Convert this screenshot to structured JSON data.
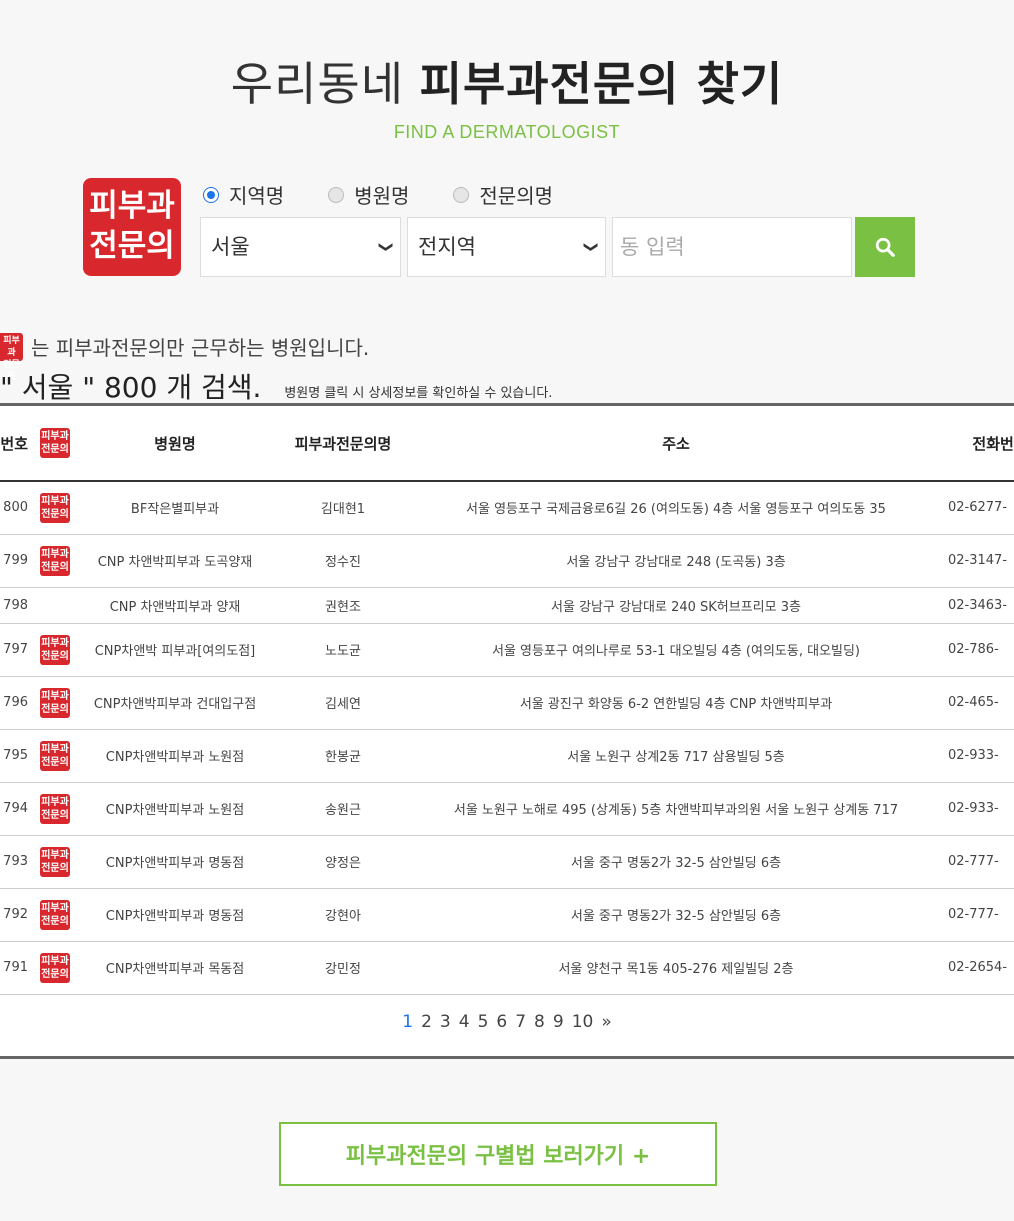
{
  "header": {
    "title_light": "우리동네",
    "title_bold": "피부과전문의 찾기",
    "subtitle": "FIND A DERMATOLOGIST"
  },
  "logo": {
    "line1": "피부과",
    "line2": "전문의"
  },
  "search": {
    "radios": [
      {
        "label": "지역명",
        "checked": true
      },
      {
        "label": "병원명",
        "checked": false
      },
      {
        "label": "전문의명",
        "checked": false
      }
    ],
    "region": "서울",
    "district": "전지역",
    "dong_placeholder": "동 입력",
    "button_icon": "search-icon",
    "accent_color": "#7ac143"
  },
  "note": {
    "badge_line1": "피부과",
    "badge_line2": "전문의",
    "text": "는 피부과전문의만 근무하는 병원입니다."
  },
  "result": {
    "summary": "\" 서울 \" 800 개 검색.",
    "hint": "병원명 클릭 시 상세정보를 확인하실 수 있습니다."
  },
  "table": {
    "headers": [
      "번호",
      "",
      "병원명",
      "피부과전문의명",
      "주소",
      "전화번호"
    ],
    "badge_line1": "피부과",
    "badge_line2": "전문의",
    "rows": [
      {
        "no": "800",
        "badge": true,
        "hospital": "BF작은별피부과",
        "doctor": "김대현1",
        "address": "서울 영등포구 국제금융로6길 26 (여의도동) 4층 서울 영등포구 여의도동 35",
        "phone": "02-6277-"
      },
      {
        "no": "799",
        "badge": true,
        "hospital": "CNP 차앤박피부과 도곡양재",
        "doctor": "정수진",
        "address": "서울 강남구 강남대로 248 (도곡동) 3층",
        "phone": "02-3147-"
      },
      {
        "no": "798",
        "badge": false,
        "hospital": "CNP 차앤박피부과 양재",
        "doctor": "권현조",
        "address": "서울 강남구 강남대로 240 SK허브프리모 3층",
        "phone": "02-3463-"
      },
      {
        "no": "797",
        "badge": true,
        "hospital": "CNP차앤박 피부과[여의도점]",
        "doctor": "노도균",
        "address": "서울 영등포구 여의나루로 53-1 대오빌딩 4층 (여의도동, 대오빌딩)",
        "phone": "02-786-"
      },
      {
        "no": "796",
        "badge": true,
        "hospital": "CNP차앤박피부과 건대입구점",
        "doctor": "김세연",
        "address": "서울 광진구 화양동 6-2 연한빌딩 4층 CNP 차앤박피부과",
        "phone": "02-465-"
      },
      {
        "no": "795",
        "badge": true,
        "hospital": "CNP차앤박피부과 노원점",
        "doctor": "한봉균",
        "address": "서울 노원구 상계2동 717 삼용빌딩 5층",
        "phone": "02-933-"
      },
      {
        "no": "794",
        "badge": true,
        "hospital": "CNP차앤박피부과 노원점",
        "doctor": "송원근",
        "address": "서울 노원구 노해로 495 (상계동) 5층 차앤박피부과의원 서울 노원구 상계동 717",
        "phone": "02-933-"
      },
      {
        "no": "793",
        "badge": true,
        "hospital": "CNP차앤박피부과 명동점",
        "doctor": "양정은",
        "address": "서울 중구 명동2가 32-5 삼안빌딩 6층",
        "phone": "02-777-"
      },
      {
        "no": "792",
        "badge": true,
        "hospital": "CNP차앤박피부과 명동점",
        "doctor": "강현아",
        "address": "서울 중구 명동2가 32-5 삼안빌딩 6층",
        "phone": "02-777-"
      },
      {
        "no": "791",
        "badge": true,
        "hospital": "CNP차앤박피부과 목동점",
        "doctor": "강민정",
        "address": "서울 양천구 목1동 405-276 제일빌딩 2층",
        "phone": "02-2654-"
      }
    ]
  },
  "pagination": {
    "pages": [
      "1",
      "2",
      "3",
      "4",
      "5",
      "6",
      "7",
      "8",
      "9",
      "10"
    ],
    "current": "1",
    "next": "»"
  },
  "guide_button": "피부과전문의 구별법 보러가기 +"
}
